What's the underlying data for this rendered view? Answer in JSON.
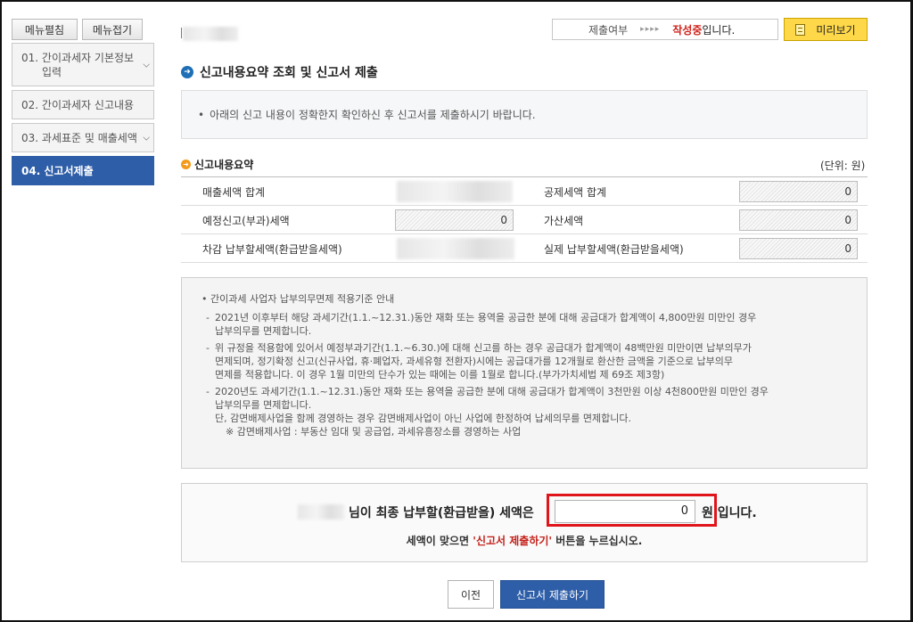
{
  "sidebar": {
    "expand_label": "메뉴펼침",
    "collapse_label": "메뉴접기",
    "items": [
      {
        "label_line1": "01. 간이과세자 기본정보",
        "label_line2": "입력"
      },
      {
        "label_line1": "02. 간이과세자 신고내용"
      },
      {
        "label_line1": "03. 과세표준 및 매출세액"
      },
      {
        "label_line1": "04. 신고서제출"
      }
    ]
  },
  "header": {
    "submit_label": "제출여부",
    "arrows": "▸▸▸▸",
    "status_value": "작성중",
    "status_suffix": "입니다.",
    "preview_label": "미리보기"
  },
  "main": {
    "title": "신고내용요약 조회 및 신고서 제출",
    "notice": "아래의 신고 내용이 정확한지 확인하신 후 신고서를 제출하시기 바랍니다.",
    "summary_title": "신고내용요약",
    "unit": "(단위: 원)",
    "summary": {
      "row1": {
        "left_label": "매출세액 합계",
        "right_label": "공제세액 합계",
        "right_value": "0"
      },
      "row2": {
        "left_label": "예정신고(부과)세액",
        "left_value": "0",
        "right_label": "가산세액",
        "right_value": "0"
      },
      "row3": {
        "left_label": "차감 납부할세액(환급받을세액)",
        "right_label": "실제 납부할세액(환급받을세액)",
        "right_value": "0"
      }
    },
    "guide": {
      "heading": "간이과세 사업자 납부의무면제 적용기준 안내",
      "item1_a": "2021년 이후부터 해당  과세기간(1.1.~12.31.)동안 재화 또는 용역을 공급한 분에 대해 공급대가 합계액이 4,800만원 미만인 경우",
      "item1_b": "납부의무를 면제합니다.",
      "item2_a": "위 규정을 적용함에 있어서 예정부과기간(1.1.~6.30.)에 대해 신고를 하는 경우 공급대가 합계액이 48백만원 미만이면 납부의무가",
      "item2_b": "면제되며, 정기확정 신고(신규사업, 휴·폐업자, 과세유형 전환자)시에는 공급대가를 12개월로 환산한 금액을 기준으로 납부의무",
      "item2_c": "면제를 적용합니다. 이 경우 1월 미만의 단수가 있는 때에는 이를 1월로 합니다.(부가가치세법 제 69조 제3항)",
      "item3_a": "2020년도 과세기간(1.1.~12.31.)동안 재화 또는 용역을 공급한 분에 대해 공급대가 합계액이 3천만원 이상 4천800만원 미만인 경우",
      "item3_b": "납부의무를 면제합니다.",
      "item3_c": "단, 감면배제사업을 함께 경영하는 경우 감면배제사업이 아닌 사업에 한정하여 납세의무를 면제합니다.",
      "item3_d": "※ 감면배제사업 : 부동산 임대 및 공급업, 과세유흥장소를 경영하는 사업"
    },
    "final": {
      "text": "님이 최종 납부할(환급받을) 세액은",
      "value": "0",
      "unit_label": "원",
      "suffix": "입니다.",
      "hint_prefix": "세액이 맞으면 ",
      "hint_highlight": "'신고서 제출하기'",
      "hint_suffix": " 버튼을 누르십시오."
    },
    "buttons": {
      "prev_label": "이전",
      "submit_label": "신고서 제출하기"
    }
  },
  "colors": {
    "accent_blue": "#2e5ea8",
    "status_red": "#d0231b",
    "highlight_red": "#e0151b",
    "preview_yellow": "#ffd84a"
  }
}
